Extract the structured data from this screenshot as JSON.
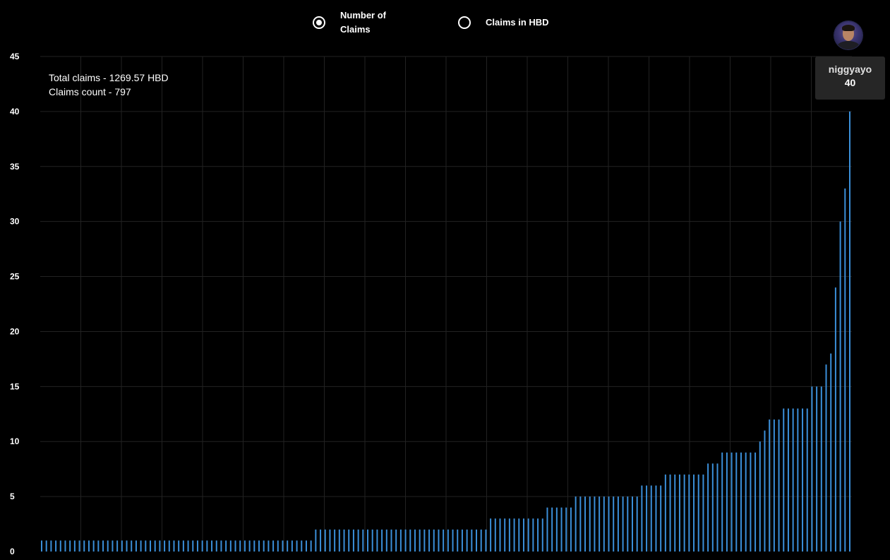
{
  "radio_options": {
    "number_of_claims": {
      "label": "Number of\nClaims",
      "selected": true
    },
    "claims_in_hbd": {
      "label": "Claims in HBD",
      "selected": false
    }
  },
  "summary": {
    "total_claims": "Total claims - 1269.57 HBD",
    "claims_count": "Claims count - 797"
  },
  "tooltip": {
    "name": "niggyayo",
    "value": "40"
  },
  "colors": {
    "background": "#000000",
    "bar": "#3b8fd9",
    "grid": "#222222",
    "text": "#ffffff",
    "tooltip_bg": "#262626"
  },
  "chart_data": {
    "type": "bar",
    "title": "",
    "xlabel": "",
    "ylabel": "",
    "ylim": [
      0,
      45
    ],
    "yticks": [
      0,
      5,
      10,
      15,
      20,
      25,
      30,
      35,
      40,
      45
    ],
    "grid": true,
    "values": [
      1,
      1,
      1,
      1,
      1,
      1,
      1,
      1,
      1,
      1,
      1,
      1,
      1,
      1,
      1,
      1,
      1,
      1,
      1,
      1,
      1,
      1,
      1,
      1,
      1,
      1,
      1,
      1,
      1,
      1,
      1,
      1,
      1,
      1,
      1,
      1,
      1,
      1,
      1,
      1,
      1,
      1,
      1,
      1,
      1,
      1,
      1,
      1,
      1,
      1,
      1,
      1,
      1,
      1,
      1,
      1,
      1,
      1,
      2,
      2,
      2,
      2,
      2,
      2,
      2,
      2,
      2,
      2,
      2,
      2,
      2,
      2,
      2,
      2,
      2,
      2,
      2,
      2,
      2,
      2,
      2,
      2,
      2,
      2,
      2,
      2,
      2,
      2,
      2,
      2,
      2,
      2,
      2,
      2,
      2,
      3,
      3,
      3,
      3,
      3,
      3,
      3,
      3,
      3,
      3,
      3,
      3,
      4,
      4,
      4,
      4,
      4,
      4,
      5,
      5,
      5,
      5,
      5,
      5,
      5,
      5,
      5,
      5,
      5,
      5,
      5,
      5,
      6,
      6,
      6,
      6,
      6,
      7,
      7,
      7,
      7,
      7,
      7,
      7,
      7,
      7,
      8,
      8,
      8,
      9,
      9,
      9,
      9,
      9,
      9,
      9,
      9,
      10,
      11,
      12,
      12,
      12,
      13,
      13,
      13,
      13,
      13,
      13,
      15,
      15,
      15,
      17,
      18,
      24,
      30,
      33,
      40
    ]
  }
}
